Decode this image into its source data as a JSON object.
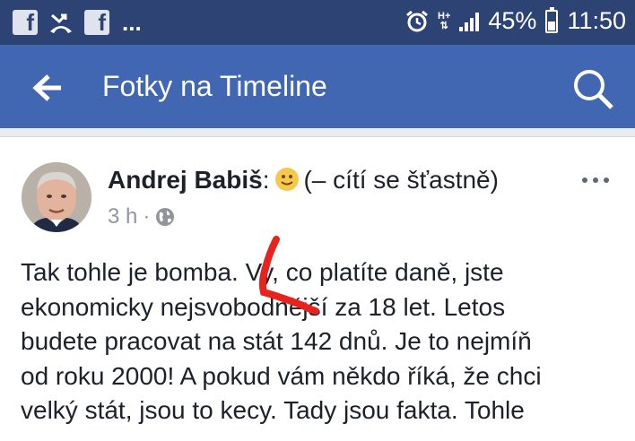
{
  "status_bar": {
    "notification_icons": [
      "facebook-icon",
      "missed-call-icon",
      "facebook-icon"
    ],
    "overflow": "...",
    "network": "H+",
    "battery_percent": "45%",
    "time": "11:50"
  },
  "app_bar": {
    "title": "Fotky na Timeline",
    "back_icon": "arrow-left-icon",
    "search_icon": "search-icon"
  },
  "post": {
    "author": "Andrej Babiš",
    "feeling_separator": ":",
    "feeling": "(– cítí se šťastně)",
    "time_ago": "3 h",
    "dot": "·",
    "privacy_icon": "globe-icon",
    "more_icon": "more-horizontal-icon",
    "lines": [
      "Tak tohle je bomba. Vy, co platíte daně, jste",
      "ekonomicky nejsvobodnější za 18 let. Letos",
      "budete pracovat na stát 142 dnů. Je to nejmíň",
      "od roku 2000! A pokud vám někdo říká, že chci",
      "velký stát, jsou to kecy. Tady jsou fakta. Tohle"
    ],
    "annotation_color": "#e8231d"
  }
}
